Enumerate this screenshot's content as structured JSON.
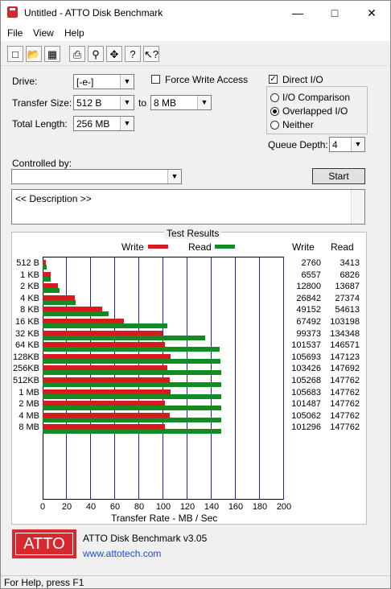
{
  "window": {
    "title": "Untitled - ATTO Disk Benchmark"
  },
  "menu": [
    "File",
    "View",
    "Help"
  ],
  "toolbar_icons": [
    "new-icon",
    "open-icon",
    "save-icon",
    "print-icon",
    "print-preview-icon",
    "move-icon",
    "help-icon",
    "context-help-icon"
  ],
  "form": {
    "drive_label": "Drive:",
    "drive_value": "[-e-]",
    "transfer_label": "Transfer Size:",
    "transfer_from": "512 B",
    "to_label": "to",
    "transfer_to": "8 MB",
    "length_label": "Total Length:",
    "length_value": "256 MB",
    "force_write": "Force Write Access",
    "direct_io": "Direct I/O",
    "io_comparison": "I/O Comparison",
    "overlapped_io": "Overlapped I/O",
    "neither": "Neither",
    "queue_label": "Queue Depth:",
    "queue_value": "4",
    "controlled_label": "Controlled by:",
    "controlled_value": "",
    "start": "Start",
    "description": "<< Description >>"
  },
  "results": {
    "title": "Test Results",
    "write_legend": "Write",
    "read_legend": "Read",
    "write_col": "Write",
    "read_col": "Read",
    "xlabel": "Transfer Rate - MB / Sec"
  },
  "chart_data": {
    "type": "bar",
    "orientation": "horizontal",
    "categories": [
      "512 B",
      "1 KB",
      "2 KB",
      "4 KB",
      "8 KB",
      "16 KB",
      "32 KB",
      "64 KB",
      "128KB",
      "256KB",
      "512KB",
      "1 MB",
      "2 MB",
      "4 MB",
      "8 MB"
    ],
    "series": [
      {
        "name": "Write",
        "color": "#d71920",
        "values": [
          2760,
          6557,
          12800,
          26842,
          49152,
          67492,
          99373,
          101537,
          105693,
          103426,
          105268,
          105683,
          101487,
          105062,
          101296
        ]
      },
      {
        "name": "Read",
        "color": "#148a22",
        "values": [
          3413,
          6826,
          13687,
          27374,
          54613,
          103198,
          134348,
          146571,
          147123,
          147692,
          147762,
          147762,
          147762,
          147762,
          147762
        ]
      }
    ],
    "xlabel": "Transfer Rate - MB / Sec",
    "xlim": [
      0,
      200
    ],
    "xticks": [
      "0",
      "20",
      "40",
      "60",
      "80",
      "100",
      "120",
      "140",
      "160",
      "180",
      "200"
    ],
    "table_unit": "KB/s"
  },
  "brand": {
    "logo": "ATTO",
    "product": "ATTO Disk Benchmark v3.05",
    "url": "www.attotech.com"
  },
  "status": "For Help, press F1"
}
